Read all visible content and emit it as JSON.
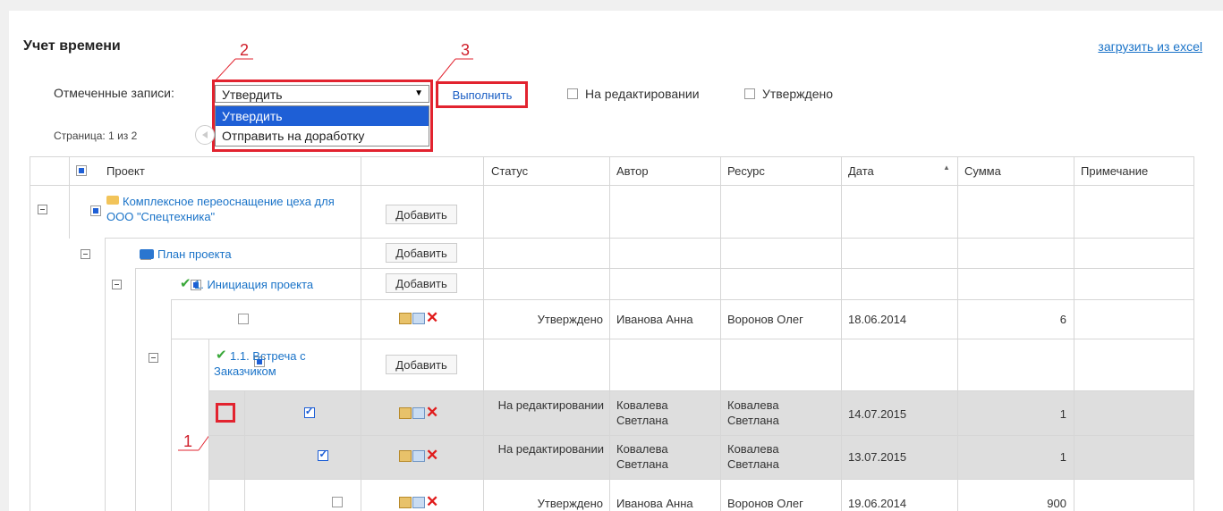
{
  "header": {
    "title": "Учет времени",
    "excel_link": "загрузить из excel"
  },
  "toolbar": {
    "marked_label": "Отмеченные записи:",
    "action_selected": "Утвердить",
    "action_options": [
      "Утвердить",
      "Отправить на доработку"
    ],
    "execute_label": "Выполнить",
    "filter_editing": "На редактировании",
    "filter_approved": "Утверждено",
    "page_info": "Страница: 1 из 2"
  },
  "annotations": [
    "1",
    "2",
    "3"
  ],
  "table": {
    "columns": [
      "Проект",
      "",
      "Статус",
      "Автор",
      "Ресурс",
      "Дата",
      "Сумма",
      "Примечание"
    ],
    "add_label": "Добавить",
    "tree": {
      "project": "Комплексное переоснащение цеха для ООО \"Спецтехника\"",
      "plan": "План проекта",
      "task1": "1. Инициация проекта",
      "task11": "1.1. Встреча с Заказчиком"
    },
    "rows": [
      {
        "status": "Утверждено",
        "author": "Иванова Анна",
        "resource": "Воронов Олег",
        "date": "18.06.2014",
        "sum": "6",
        "note": ""
      },
      {
        "status": "На редактировании",
        "author": "Ковалева Светлана",
        "resource": "Ковалева Светлана",
        "date": "14.07.2015",
        "sum": "1",
        "note": ""
      },
      {
        "status": "На редактировании",
        "author": "Ковалева Светлана",
        "resource": "Ковалева Светлана",
        "date": "13.07.2015",
        "sum": "1",
        "note": ""
      },
      {
        "status": "Утверждено",
        "author": "Иванова Анна",
        "resource": "Воронов Олег",
        "date": "19.06.2014",
        "sum": "900",
        "note": ""
      }
    ]
  },
  "colors": {
    "link": "#1a73c8",
    "selection": "#1e5fd6",
    "annotation": "#e2232f",
    "highlight_row": "#dedede"
  },
  "icons": {
    "folder": "folder-icon",
    "project": "project-folder-icon",
    "check": "check-icon",
    "edit": "edit-icon",
    "copy": "copy-icon",
    "delete": "delete-icon"
  }
}
